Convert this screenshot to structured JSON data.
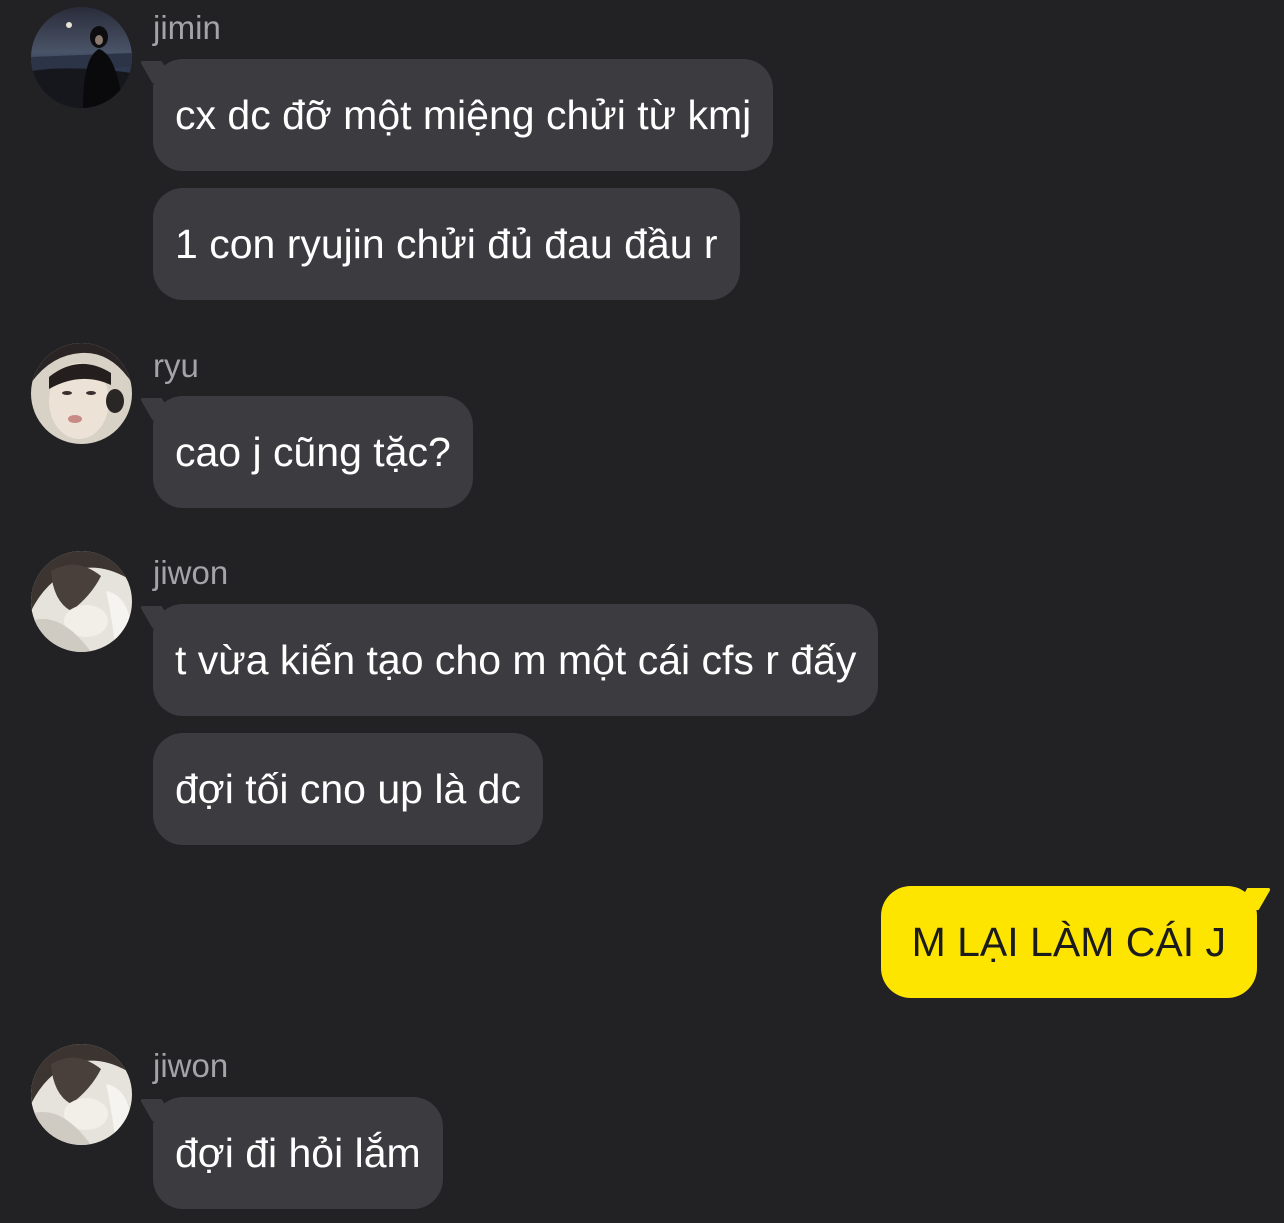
{
  "messages": [
    {
      "sender": "jimin",
      "avatar": "jimin-avatar",
      "bubbles": [
        "cx dc đỡ một miệng chửi từ kmj",
        "1 con ryujin chửi đủ đau đầu r"
      ]
    },
    {
      "sender": "ryu",
      "avatar": "ryu-avatar",
      "bubbles": [
        "cao j cũng tặc?"
      ]
    },
    {
      "sender": "jiwon",
      "avatar": "jiwon-avatar",
      "bubbles": [
        "t vừa kiến tạo cho m một cái cfs r đấy",
        "đợi tối cno up là dc"
      ]
    },
    {
      "mine": true,
      "bubbles": [
        "M LẠI LÀM CÁI J"
      ]
    },
    {
      "sender": "jiwon",
      "avatar": "jiwon-avatar",
      "bubbles": [
        "đợi đi hỏi lắm"
      ]
    }
  ],
  "colors": {
    "background": "#222225",
    "incoming_bubble": "#3c3c40",
    "outgoing_bubble": "#fee500",
    "sender_name": "#a3a3a8"
  }
}
